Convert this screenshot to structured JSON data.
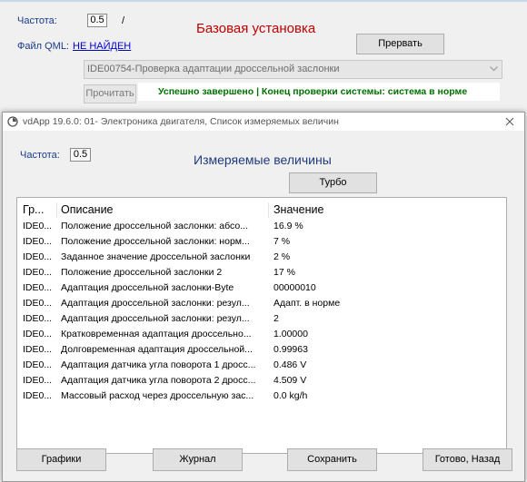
{
  "background_window": {
    "freq_label": "Частота:",
    "freq_value": "0.5",
    "slash": "/",
    "title": "Базовая установка",
    "qml_label": "Файл QML:",
    "qml_status": "НЕ НАЙДЕН",
    "stop_button": "Прервать",
    "dropdown_value": "IDE00754-Проверка адаптации дроссельной заслонки",
    "read_button": "Прочитать",
    "status_text": "Успешно завершено | Конец проверки системы: система в норме"
  },
  "dialog": {
    "title": "vdApp 19.6.0: 01- Электроника двигателя,  Список измеряемых величин",
    "freq_label": "Частота:",
    "freq_value": "0.5",
    "heading": "Измеряемые величины",
    "turbo_button": "Турбо",
    "columns": [
      "Гр...",
      "Описание",
      "Значение"
    ],
    "rows": [
      {
        "group": "IDE0...",
        "desc": "Положение дроссельной заслонки: абсо...",
        "value": "16.9 %"
      },
      {
        "group": "IDE0...",
        "desc": "Положение дроссельной заслонки: норм...",
        "value": "7 %"
      },
      {
        "group": "IDE0...",
        "desc": "Заданное значение дроссельной заслонки",
        "value": "2 %"
      },
      {
        "group": "IDE0...",
        "desc": "Положение дроссельной заслонки 2",
        "value": "17 %"
      },
      {
        "group": "IDE0...",
        "desc": "Адаптация дроссельной заслонки-Byte",
        "value": "00000010"
      },
      {
        "group": "IDE0...",
        "desc": "Адаптация дроссельной заслонки: резул...",
        "value": "Адапт. в норме"
      },
      {
        "group": "IDE0...",
        "desc": "Адаптация дроссельной заслонки: резул...",
        "value": "2"
      },
      {
        "group": "IDE0...",
        "desc": "Кратковременная адаптация дроссельно...",
        "value": "1.00000"
      },
      {
        "group": "IDE0...",
        "desc": "Долговременная адаптация дроссельной...",
        "value": "0.99963"
      },
      {
        "group": "IDE0...",
        "desc": "Адаптация датчика угла поворота 1 дросс...",
        "value": "0.486 V"
      },
      {
        "group": "IDE0...",
        "desc": "Адаптация датчика угла поворота 2 дросс...",
        "value": "4.509 V"
      },
      {
        "group": "IDE0...",
        "desc": "Массовый расход через дроссельную зас...",
        "value": "0.0 kg/h"
      }
    ],
    "buttons": {
      "graphs": "Графики",
      "journal": "Журнал",
      "save": "Сохранить",
      "done": "Готово, Назад"
    }
  },
  "colors": {
    "title_red": "#c00000",
    "status_green": "#007000",
    "heading_blue": "#1f3a7a",
    "link_blue": "#0000cc"
  }
}
